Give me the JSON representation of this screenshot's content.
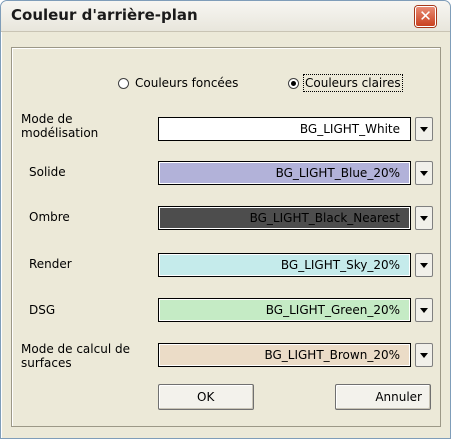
{
  "window": {
    "title": "Couleur d'arrière-plan",
    "close_glyph": "✕"
  },
  "color_scheme": {
    "dark_label": "Couleurs foncées",
    "light_label": "Couleurs claires",
    "selected": "light"
  },
  "rows": [
    {
      "label": "Mode de modélisation",
      "value": "BG_LIGHT_White",
      "color": "#ffffff"
    },
    {
      "label": "Solide",
      "value": "BG_LIGHT_Blue_20%",
      "color": "#b2b2d9"
    },
    {
      "label": "Ombre",
      "value": "BG_LIGHT_Black_Nearest",
      "color": "#4d4d4d"
    },
    {
      "label": "Render",
      "value": "BG_LIGHT_Sky_20%",
      "color": "#c5ebeb"
    },
    {
      "label": "DSG",
      "value": "BG_LIGHT_Green_20%",
      "color": "#c5ebc5"
    },
    {
      "label": "Mode de calcul de surfaces",
      "value": "BG_LIGHT_Brown_20%",
      "color": "#ebdcc7"
    }
  ],
  "buttons": {
    "ok": "OK",
    "cancel": "Annuler"
  }
}
